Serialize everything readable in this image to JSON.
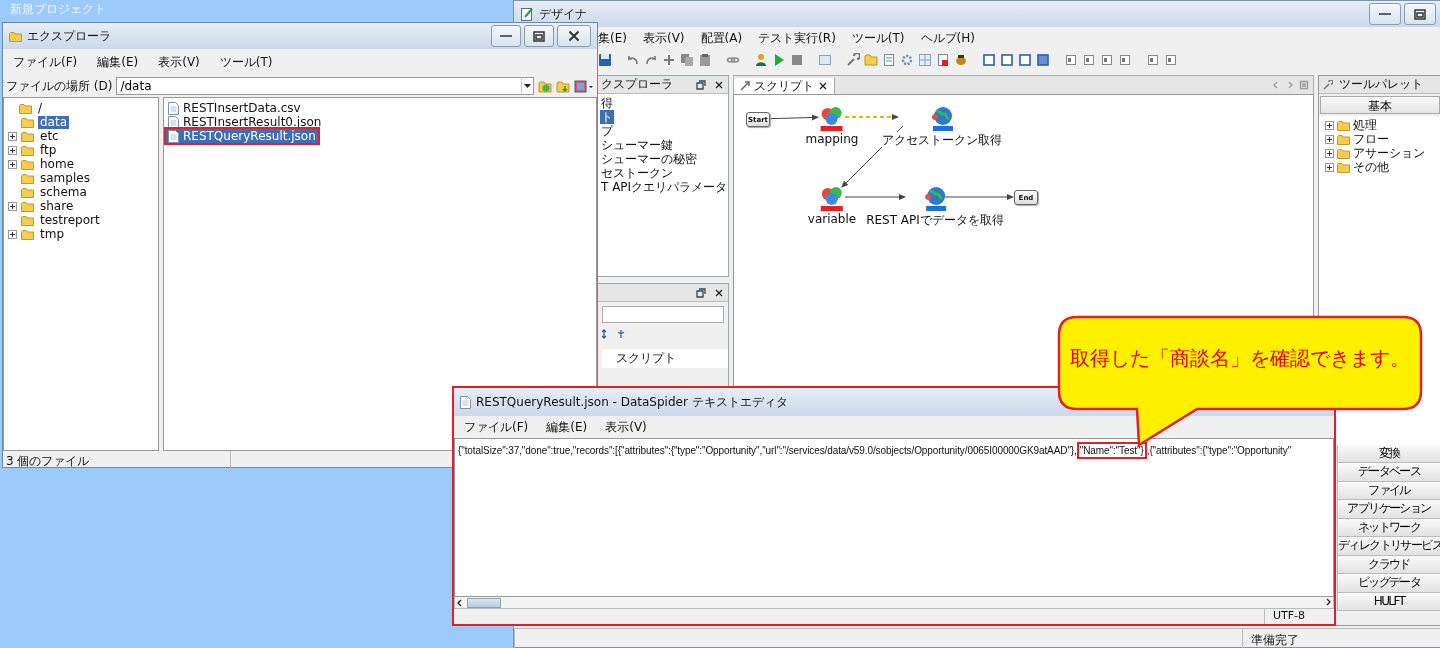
{
  "desktop": {
    "project_name": "新規プロジェクト"
  },
  "designer": {
    "title": "デザイナ",
    "menu": [
      "集(E)",
      "表示(V)",
      "配置(A)",
      "テスト実行(R)",
      "ツール(T)",
      "ヘルプ(H)"
    ],
    "explorer_pane": {
      "title": "クスプローラ",
      "items": [
        {
          "label": "得",
          "selected": false
        },
        {
          "label": "ト",
          "selected": true
        },
        {
          "label": "プ",
          "selected": false
        },
        {
          "label": "シューマー鍵",
          "selected": false
        },
        {
          "label": "シューマーの秘密",
          "selected": false
        },
        {
          "label": "セストークン",
          "selected": false
        },
        {
          "label": "T APIクエリパラメータ",
          "selected": false
        }
      ]
    },
    "property_pane": {
      "row": "スクリプト"
    },
    "script_tab": {
      "label": "スクリプト"
    },
    "diagram": {
      "nodes": [
        {
          "kind": "terminal",
          "label": "Start"
        },
        {
          "kind": "mapper",
          "label": "mapping"
        },
        {
          "kind": "rest",
          "label": "アクセストークン取得"
        },
        {
          "kind": "variable",
          "label": "variable"
        },
        {
          "kind": "rest",
          "label": "REST APIでデータを取得"
        },
        {
          "kind": "terminal",
          "label": "End"
        }
      ],
      "edges": [
        {
          "kind": "flow"
        },
        {
          "kind": "data"
        },
        {
          "kind": "flow"
        },
        {
          "kind": "flow"
        },
        {
          "kind": "flow"
        }
      ]
    },
    "palette": {
      "title": "ツールパレット",
      "top_category": "基本",
      "tree": [
        {
          "label": "処理",
          "expanded": false
        },
        {
          "label": "フロー",
          "expanded": false
        },
        {
          "label": "アサーション",
          "expanded": false
        },
        {
          "label": "その他",
          "expanded": false
        }
      ],
      "categories": [
        "変換",
        "データベース",
        "ファイル",
        "アプリケーション",
        "ネットワーク",
        "ディレクトリサービス",
        "クラウド",
        "ビッグデータ",
        "HULFT"
      ]
    },
    "status": "準備完了"
  },
  "explorer": {
    "title": "エクスプローラ",
    "menu": [
      "ファイル(F)",
      "編集(E)",
      "表示(V)",
      "ツール(T)"
    ],
    "location_label": "ファイルの場所 (D)",
    "location": "/data",
    "tree": [
      {
        "label": "/",
        "selected": false,
        "children": [
          {
            "label": "data",
            "selected": true,
            "has_children": false
          },
          {
            "label": "etc",
            "selected": false,
            "has_children": true
          },
          {
            "label": "ftp",
            "selected": false,
            "has_children": true
          },
          {
            "label": "home",
            "selected": false,
            "has_children": true
          },
          {
            "label": "samples",
            "selected": false,
            "has_children": false
          },
          {
            "label": "schema",
            "selected": false,
            "has_children": false
          },
          {
            "label": "share",
            "selected": false,
            "has_children": true
          },
          {
            "label": "testreport",
            "selected": false,
            "has_children": false
          },
          {
            "label": "tmp",
            "selected": false,
            "has_children": true
          }
        ]
      }
    ],
    "files": [
      {
        "name": "RESTInsertData.csv",
        "selected": false,
        "highlighted": false
      },
      {
        "name": "RESTInsertResult0.json",
        "selected": false,
        "highlighted": false
      },
      {
        "name": "RESTQueryResult.json",
        "selected": true,
        "highlighted": true
      }
    ],
    "status": "3 個のファイル"
  },
  "editor": {
    "title": "RESTQueryResult.json - DataSpider テキストエディタ",
    "menu": [
      "ファイル(F)",
      "編集(E)",
      "表示(V)"
    ],
    "content": [
      {
        "text": "{\"totalSize\":37,\"done\":true,\"records\":[{\"attributes\":{\"type\":\"Opportunity\",\"url\":\"/services/data/v59.0/sobjects/Opportunity/0065I00000GK9atAAD\"},",
        "highlighted": false
      },
      {
        "text": "\"Name\":\"Test\"}",
        "highlighted": true
      },
      {
        "text": ",{\"attributes\":{\"type\":\"Opportunity\"",
        "highlighted": false
      }
    ],
    "encoding": "UTF-8"
  },
  "callout": {
    "text": "取得した「商談名」を確認できます。"
  }
}
